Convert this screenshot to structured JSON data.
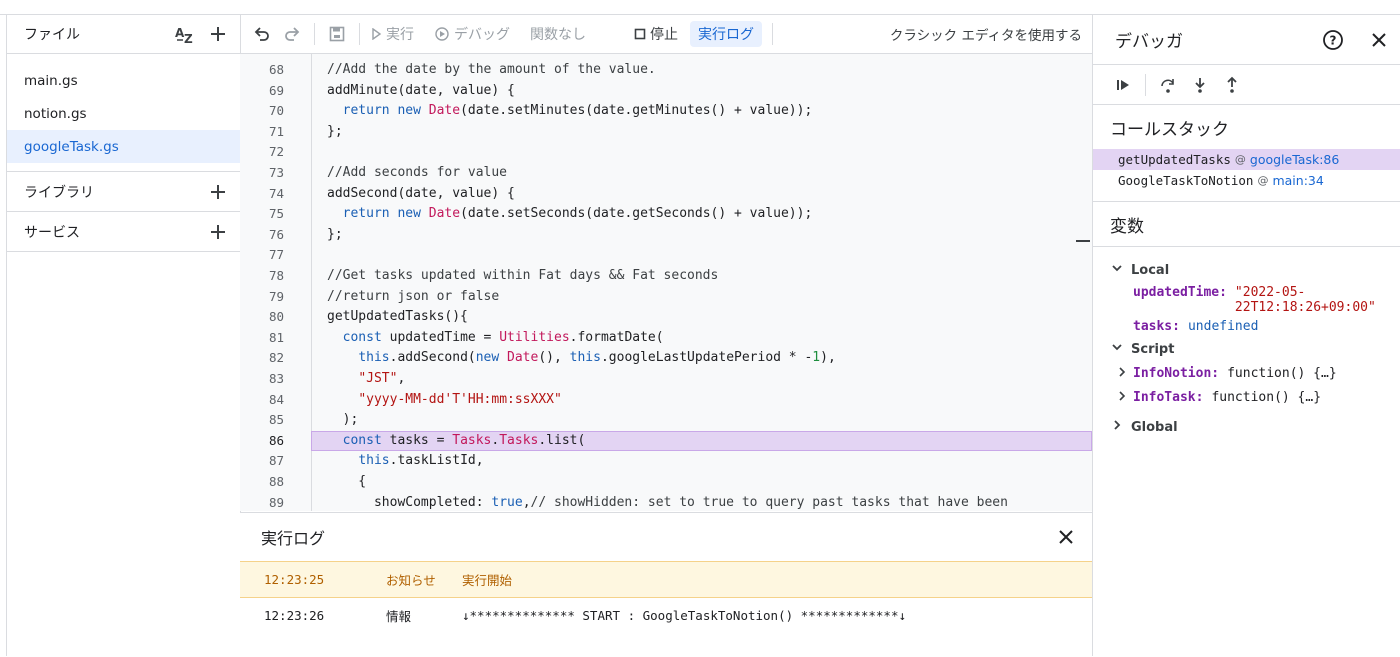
{
  "files": {
    "header": "ファイル",
    "items": [
      "main.gs",
      "notion.gs",
      "googleTask.gs"
    ],
    "active_index": 2,
    "library_label": "ライブラリ",
    "services_label": "サービス"
  },
  "toolbar": {
    "run_label": "実行",
    "debug_label": "デバッグ",
    "function_label": "関数なし",
    "stop_label": "停止",
    "log_label": "実行ログ",
    "classic_label": "クラシック エディタを使用する"
  },
  "editor": {
    "current_line": 86,
    "lines": [
      {
        "n": "68",
        "html": "<span class=\"cm\">//Add the date by the amount of the value.</span>"
      },
      {
        "n": "69",
        "html": "addMinute(date, value) {"
      },
      {
        "n": "70",
        "html": "  <span class=\"kw\">return</span> <span class=\"kw\">new</span> <span class=\"cls\">Date</span>(date.setMinutes(date.getMinutes() + value));"
      },
      {
        "n": "71",
        "html": "};"
      },
      {
        "n": "72",
        "html": ""
      },
      {
        "n": "73",
        "html": "<span class=\"cm\">//Add seconds for value</span>"
      },
      {
        "n": "74",
        "html": "addSecond(date, value) {"
      },
      {
        "n": "75",
        "html": "  <span class=\"kw\">return</span> <span class=\"kw\">new</span> <span class=\"cls\">Date</span>(date.setSeconds(date.getSeconds() + value));"
      },
      {
        "n": "76",
        "html": "};"
      },
      {
        "n": "77",
        "html": ""
      },
      {
        "n": "78",
        "html": "<span class=\"cm\">//Get tasks updated within Fat days &amp;&amp; Fat seconds</span>"
      },
      {
        "n": "79",
        "html": "<span class=\"cm\">//return json or false</span>"
      },
      {
        "n": "80",
        "html": "getUpdatedTasks(){"
      },
      {
        "n": "81",
        "html": "  <span class=\"kw\">const</span> updatedTime = <span class=\"cls\">Utilities</span>.formatDate("
      },
      {
        "n": "82",
        "html": "    <span class=\"kw\">this</span>.addSecond(<span class=\"kw\">new</span> <span class=\"cls\">Date</span>(), <span class=\"kw\">this</span>.googleLastUpdatePeriod * -<span class=\"num\">1</span>),"
      },
      {
        "n": "83",
        "html": "    <span class=\"str\">\"JST\"</span>,"
      },
      {
        "n": "84",
        "html": "    <span class=\"str\">\"yyyy-MM-dd'T'HH:mm:ssXXX\"</span>"
      },
      {
        "n": "85",
        "html": "  );"
      },
      {
        "n": "86",
        "html": "  <span class=\"kw\">const</span> tasks = <span class=\"cls\">Tasks</span>.<span class=\"cls\">Tasks</span>.list("
      },
      {
        "n": "87",
        "html": "    <span class=\"kw\">this</span>.taskListId,"
      },
      {
        "n": "88",
        "html": "    {"
      },
      {
        "n": "89",
        "html": "      showCompleted: <span class=\"kw\">true</span>,<span class=\"cm\">// showHidden: set to true to query past tasks that have been</span>"
      }
    ]
  },
  "log": {
    "title": "実行ログ",
    "rows": [
      {
        "time": "12:23:25",
        "level": "お知らせ",
        "message": "実行開始"
      },
      {
        "time": "12:23:26",
        "level": "情報",
        "message": "↓************** START : GoogleTaskToNotion()  *************↓"
      }
    ]
  },
  "debugger": {
    "title": "デバッガ",
    "callstack_label": "コールスタック",
    "callstack": [
      {
        "fn": "getUpdatedTasks",
        "at": "@",
        "loc": "googleTask:86"
      },
      {
        "fn": "GoogleTaskToNotion",
        "at": "@",
        "loc": "main:34"
      }
    ],
    "variables_label": "変数",
    "scopes": {
      "local_label": "Local",
      "script_label": "Script",
      "global_label": "Global"
    },
    "local_vars": [
      {
        "key": "updatedTime:",
        "value": "\"2022-05-22T12:18:26+09:00\""
      },
      {
        "key": "tasks:",
        "value": "undefined"
      }
    ],
    "script_vars": [
      {
        "key": "InfoNotion:",
        "value": "function() {…}"
      },
      {
        "key": "InfoTask:",
        "value": "function() {…}"
      }
    ]
  }
}
